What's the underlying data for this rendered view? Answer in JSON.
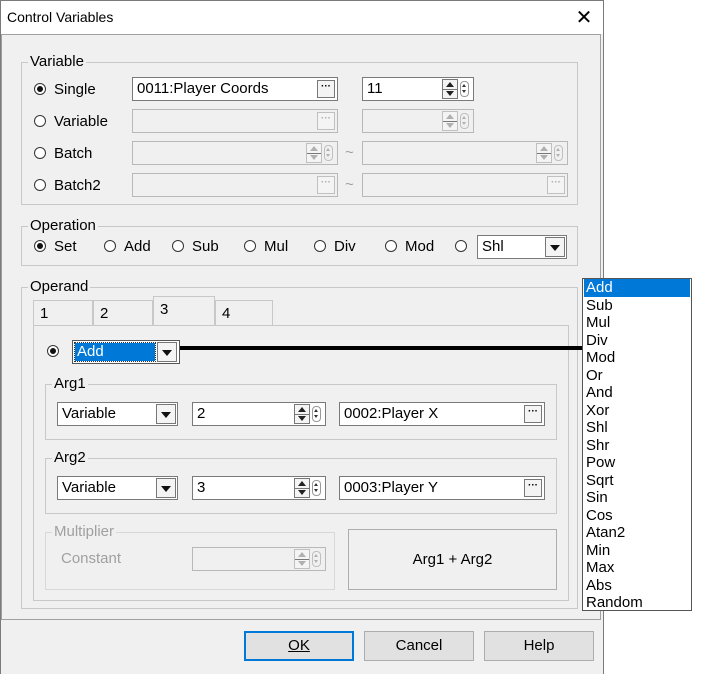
{
  "window": {
    "title": "Control Variables"
  },
  "variable": {
    "legend": "Variable",
    "options": [
      "Single",
      "Variable",
      "Batch",
      "Batch2"
    ],
    "selected": "Single",
    "single_value": "0011:Player Coords",
    "single_count": "11",
    "tilde": "~"
  },
  "operation": {
    "legend": "Operation",
    "options": [
      "Set",
      "Add",
      "Sub",
      "Mul",
      "Div",
      "Mod"
    ],
    "selected": "Set",
    "extra_select": "Shl"
  },
  "operand": {
    "legend": "Operand",
    "tabs": [
      "1",
      "2",
      "3",
      "4"
    ],
    "active_tab": "3",
    "function_select": "Add",
    "arg1": {
      "legend": "Arg1",
      "type": "Variable",
      "number": "2",
      "variable": "0002:Player X"
    },
    "arg2": {
      "legend": "Arg2",
      "type": "Variable",
      "number": "3",
      "variable": "0003:Player Y"
    },
    "multiplier": {
      "legend": "Multiplier",
      "label": "Constant",
      "value": ""
    },
    "formula": "Arg1 + Arg2"
  },
  "dropdown": {
    "items": [
      "Add",
      "Sub",
      "Mul",
      "Div",
      "Mod",
      "Or",
      "And",
      "Xor",
      "Shl",
      "Shr",
      "Pow",
      "Sqrt",
      "Sin",
      "Cos",
      "Atan2",
      "Min",
      "Max",
      "Abs",
      "Random"
    ],
    "selected": "Add"
  },
  "buttons": {
    "ok": "OK",
    "cancel": "Cancel",
    "help": "Help"
  },
  "icons": {
    "close": "close-icon",
    "browse": "ellipsis-icon",
    "spinner": "up-down-spinner-icon",
    "dropdown": "chevron-down-icon"
  }
}
